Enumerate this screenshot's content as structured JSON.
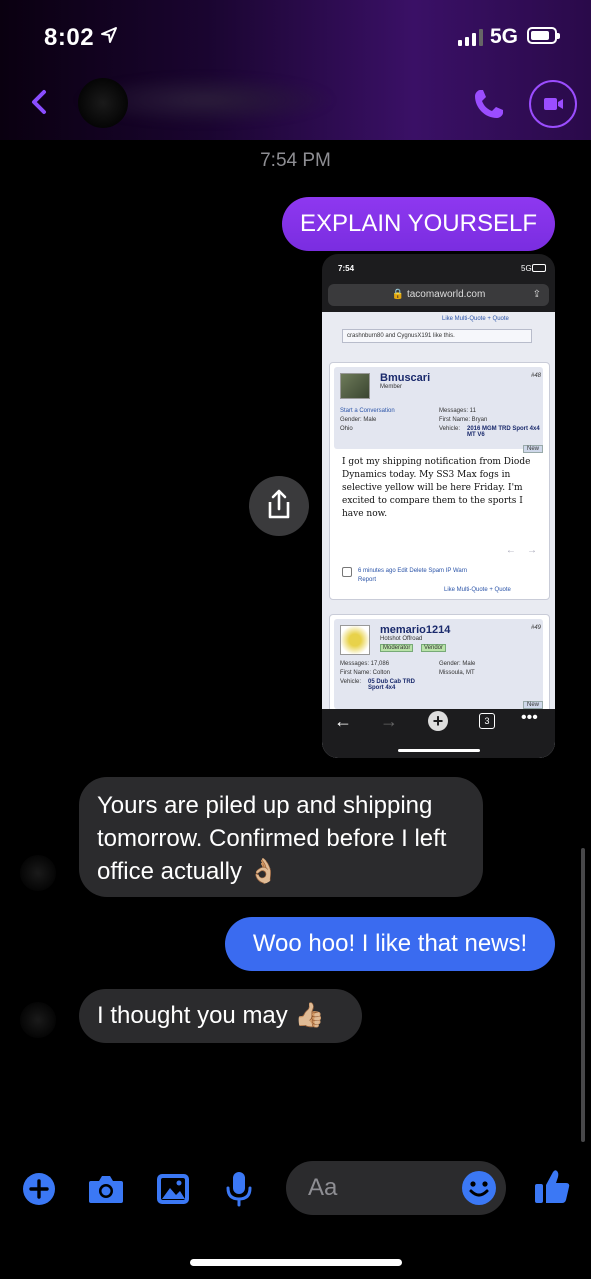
{
  "status_bar": {
    "time": "8:02",
    "network": "5G"
  },
  "conversation": {
    "timestamp": "7:54 PM",
    "messages": [
      {
        "sender": "me",
        "text": "EXPLAIN YOURSELF"
      },
      {
        "sender": "them",
        "text": "Yours are piled up and shipping tomorrow. Confirmed before I left office actually 👌🏼"
      },
      {
        "sender": "me",
        "text": "Woo hoo! I like that news!"
      },
      {
        "sender": "them",
        "text": "I thought you may 👍🏼"
      }
    ]
  },
  "screenshot": {
    "status_time": "7:54",
    "status_network": "5G",
    "url": "tacomaworld.com",
    "top_actions": "Like   Multi-Quote +   Quote",
    "likes_text": "crashnburn80 and CygnusX191 like this.",
    "post1": {
      "username": "Bmuscari",
      "role": "Member",
      "number": "#48",
      "start_convo": "Start a Conversation",
      "gender": "Gender: Male",
      "location": "Ohio",
      "messages": "Messages: 11",
      "first_name": "First Name: Bryan",
      "vehicle_label": "Vehicle:",
      "vehicle": "2016 MGM TRD Sport 4x4 MT V6",
      "new_badge": "New",
      "body": "I got my shipping notification from Diode Dynamics today. My SS3 Max fogs in selective yellow will be here Friday. I'm excited to compare them to the sports I have now.",
      "meta": "6 minutes ago   Edit   Delete   Spam   IP   Warn",
      "report": "Report",
      "actions": "Like   Multi-Quote +   Quote"
    },
    "post2": {
      "username": "memario1214",
      "role": "Hotshot Offroad",
      "badge_moderator": "Moderator",
      "badge_vendor": "Vendor",
      "number": "#49",
      "messages": "Messages: 17,086",
      "first_name": "First Name: Colton",
      "vehicle_label": "Vehicle:",
      "vehicle": "05 Dub Cab TRD Sport 4x4",
      "gender": "Gender: Male",
      "location": "Missoula, MT",
      "new_badge": "New"
    },
    "tabs_count": "3"
  },
  "composer": {
    "placeholder": "Aa"
  },
  "colors": {
    "accent_purple": "#8a2be2",
    "sent_blue": "#3a6bf0",
    "received_gray": "#2b2b2d",
    "icon_blue": "#3b78f5"
  }
}
